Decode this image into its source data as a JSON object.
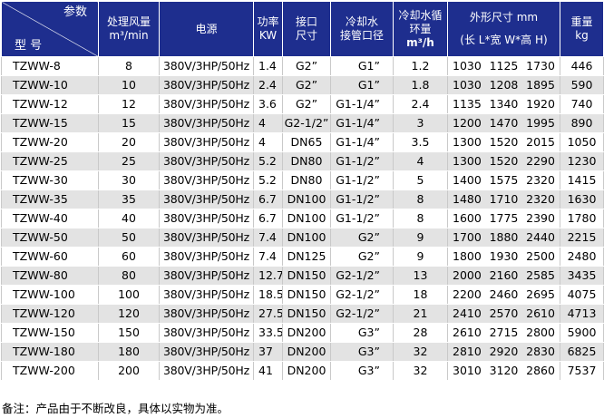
{
  "header": {
    "param_label": "参数",
    "model_label": "型 号",
    "airflow_line1": "处理风量",
    "airflow_unit": "m³/min",
    "power_source": "电源",
    "kw_line1": "功率",
    "kw_line2": "KW",
    "port_line1": "接口",
    "port_line2": "尺寸",
    "cooling_port_line1": "冷却水",
    "cooling_port_line2": "接管口径",
    "cooling_flow_line1": "冷却水循",
    "cooling_flow_line2": "环量",
    "cooling_flow_unit": "m³/h",
    "dims_line1": "外形尺寸 mm",
    "dims_line2": "(长 L*宽 W*高 H)",
    "weight_line1": "重量",
    "weight_line2": "kg"
  },
  "rows": [
    {
      "model": "TZWW-8",
      "airflow": "8",
      "power": "380V/3HP/50Hz",
      "kw": "1.4",
      "port": "G2”",
      "cooling_port": "G1”",
      "flow": "1.2",
      "l": "1030",
      "w": "1125",
      "h": "1730",
      "weight": "446"
    },
    {
      "model": "TZWW-10",
      "airflow": "10",
      "power": "380V/3HP/50Hz",
      "kw": "2.4",
      "port": "G2”",
      "cooling_port": "G1”",
      "flow": "1.8",
      "l": "1030",
      "w": "1208",
      "h": "1895",
      "weight": "590"
    },
    {
      "model": "TZWW-12",
      "airflow": "12",
      "power": "380V/3HP/50Hz",
      "kw": "3.6",
      "port": "G2”",
      "cooling_port": "G1-1/4”",
      "flow": "2.4",
      "l": "1135",
      "w": "1340",
      "h": "1920",
      "weight": "740"
    },
    {
      "model": "TZWW-15",
      "airflow": "15",
      "power": "380V/3HP/50Hz",
      "kw": "4",
      "port": "G2-1/2”",
      "cooling_port": "G1-1/4”",
      "flow": "3",
      "l": "1200",
      "w": "1470",
      "h": "1995",
      "weight": "890"
    },
    {
      "model": "TZWW-20",
      "airflow": "20",
      "power": "380V/3HP/50Hz",
      "kw": "4",
      "port": "DN65",
      "cooling_port": "G1-1/4”",
      "flow": "3.5",
      "l": "1300",
      "w": "1520",
      "h": "2015",
      "weight": "1050"
    },
    {
      "model": "TZWW-25",
      "airflow": "25",
      "power": "380V/3HP/50Hz",
      "kw": "5.2",
      "port": "DN80",
      "cooling_port": "G1-1/2”",
      "flow": "4",
      "l": "1300",
      "w": "1520",
      "h": "2290",
      "weight": "1230"
    },
    {
      "model": "TZWW-30",
      "airflow": "30",
      "power": "380V/3HP/50Hz",
      "kw": "5.2",
      "port": "DN80",
      "cooling_port": "G1-1/2”",
      "flow": "5",
      "l": "1400",
      "w": "1575",
      "h": "2320",
      "weight": "1415"
    },
    {
      "model": "TZWW-35",
      "airflow": "35",
      "power": "380V/3HP/50Hz",
      "kw": "6.7",
      "port": "DN100",
      "cooling_port": "G1-1/2”",
      "flow": "8",
      "l": "1480",
      "w": "1710",
      "h": "2320",
      "weight": "1630"
    },
    {
      "model": "TZWW-40",
      "airflow": "40",
      "power": "380V/3HP/50Hz",
      "kw": "6.7",
      "port": "DN100",
      "cooling_port": "G1-1/2”",
      "flow": "8",
      "l": "1600",
      "w": "1775",
      "h": "2390",
      "weight": "1780"
    },
    {
      "model": "TZWW-50",
      "airflow": "50",
      "power": "380V/3HP/50Hz",
      "kw": "7.4",
      "port": "DN100",
      "cooling_port": "G2”",
      "flow": "9",
      "l": "1700",
      "w": "1880",
      "h": "2440",
      "weight": "2215"
    },
    {
      "model": "TZWW-60",
      "airflow": "60",
      "power": "380V/3HP/50Hz",
      "kw": "7.4",
      "port": "DN125",
      "cooling_port": "G2”",
      "flow": "9",
      "l": "1800",
      "w": "1930",
      "h": "2500",
      "weight": "2480"
    },
    {
      "model": "TZWW-80",
      "airflow": "80",
      "power": "380V/3HP/50Hz",
      "kw": "12.7",
      "port": "DN150",
      "cooling_port": "G2-1/2”",
      "flow": "13",
      "l": "2000",
      "w": "2160",
      "h": "2585",
      "weight": "3435"
    },
    {
      "model": "TZWW-100",
      "airflow": "100",
      "power": "380V/3HP/50Hz",
      "kw": "18.5",
      "port": "DN150",
      "cooling_port": "G2-1/2”",
      "flow": "18",
      "l": "2200",
      "w": "2460",
      "h": "2695",
      "weight": "4075"
    },
    {
      "model": "TZWW-120",
      "airflow": "120",
      "power": "380V/3HP/50Hz",
      "kw": "27.5",
      "port": "DN150",
      "cooling_port": "G2-1/2”",
      "flow": "21",
      "l": "2410",
      "w": "2570",
      "h": "2610",
      "weight": "4713"
    },
    {
      "model": "TZWW-150",
      "airflow": "150",
      "power": "380V/3HP/50Hz",
      "kw": "33.5",
      "port": "DN200",
      "cooling_port": "G3”",
      "flow": "28",
      "l": "2610",
      "w": "2715",
      "h": "2800",
      "weight": "5900"
    },
    {
      "model": "TZWW-180",
      "airflow": "180",
      "power": "380V/3HP/50Hz",
      "kw": "37",
      "port": "DN200",
      "cooling_port": "G3”",
      "flow": "32",
      "l": "2810",
      "w": "2920",
      "h": "2830",
      "weight": "6825"
    },
    {
      "model": "TZWW-200",
      "airflow": "200",
      "power": "380V/3HP/50Hz",
      "kw": "41",
      "port": "DN200",
      "cooling_port": "G3”",
      "flow": "32",
      "l": "3010",
      "w": "3120",
      "h": "2860",
      "weight": "7537"
    }
  ],
  "note": "备注：产品由于不断改良，具体以实物为准。",
  "colors": {
    "header_bg": "#1e2e8e",
    "stripe": "#e3e3e3"
  }
}
